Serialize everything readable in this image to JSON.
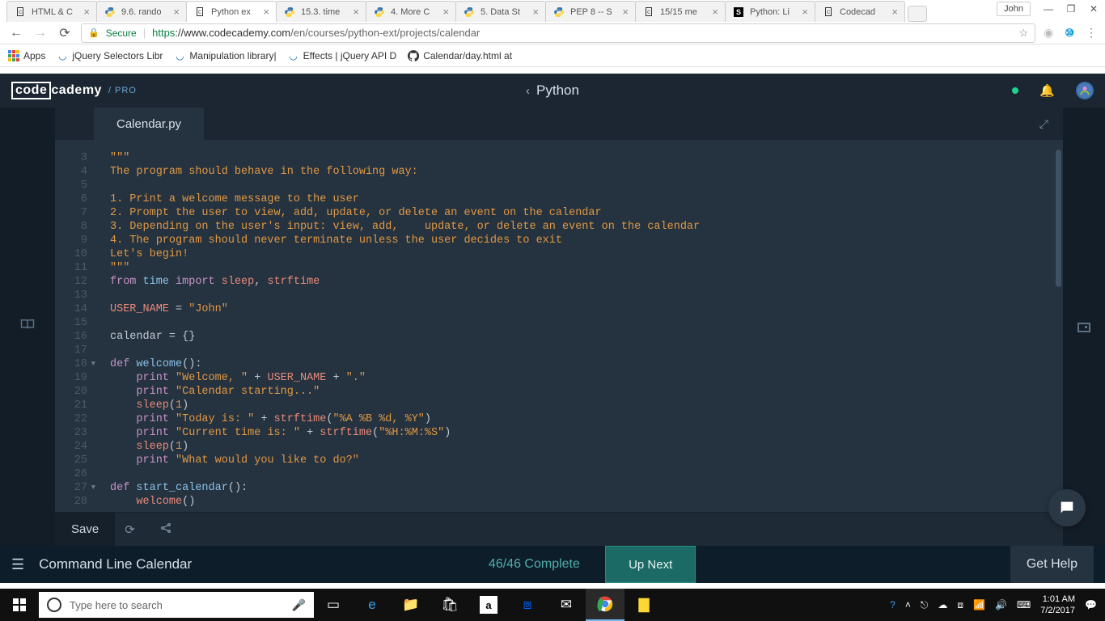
{
  "browser": {
    "tabs": [
      {
        "favicon": "cc",
        "title": "HTML & C"
      },
      {
        "favicon": "py",
        "title": "9.6. rando"
      },
      {
        "favicon": "cc",
        "title": "Python ex"
      },
      {
        "favicon": "py",
        "title": "15.3. time"
      },
      {
        "favicon": "py",
        "title": "4. More C"
      },
      {
        "favicon": "py",
        "title": "5. Data St"
      },
      {
        "favicon": "py",
        "title": "PEP 8 -- S"
      },
      {
        "favicon": "cc",
        "title": "15/15 me"
      },
      {
        "favicon": "s",
        "title": "Python: Li"
      },
      {
        "favicon": "cc",
        "title": "Codecad"
      }
    ],
    "active_tab_index": 2,
    "user_label": "John",
    "secure_label": "Secure",
    "url_proto": "https",
    "url_host": "://www.codecademy.com",
    "url_path": "/en/courses/python-ext/projects/calendar",
    "bookmarks": [
      {
        "label": "Apps"
      },
      {
        "label": "jQuery Selectors Libr"
      },
      {
        "label": "Manipulation library|"
      },
      {
        "label": "Effects | jQuery API D"
      },
      {
        "label": "Calendar/day.html at"
      }
    ]
  },
  "app": {
    "logo_left": "code",
    "logo_right": "cademy",
    "logo_pro": "/ PRO",
    "breadcrumb": "Python",
    "file_tab": "Calendar.py",
    "gutter_start": 3,
    "gutter_end": 28,
    "fold_lines": [
      18,
      27
    ],
    "code_rows": [
      [
        {
          "cls": "str",
          "t": "\"\"\""
        }
      ],
      [
        {
          "cls": "str",
          "t": "The program should behave in the following way:"
        }
      ],
      [],
      [
        {
          "cls": "str",
          "t": "1. Print a welcome message to the user"
        }
      ],
      [
        {
          "cls": "str",
          "t": "2. Prompt the user to view, add, update, or delete an event on the calendar"
        }
      ],
      [
        {
          "cls": "str",
          "t": "3. Depending on the user's input: view, add,    update, or delete an event on the calendar"
        }
      ],
      [
        {
          "cls": "str",
          "t": "4. The program should never terminate unless the user decides to exit"
        }
      ],
      [
        {
          "cls": "str",
          "t": "Let's begin!"
        }
      ],
      [
        {
          "cls": "str",
          "t": "\"\"\""
        }
      ],
      [
        {
          "cls": "kw",
          "t": "from"
        },
        {
          "cls": "op",
          "t": " "
        },
        {
          "cls": "kw2",
          "t": "time"
        },
        {
          "cls": "op",
          "t": " "
        },
        {
          "cls": "kw",
          "t": "import"
        },
        {
          "cls": "op",
          "t": " "
        },
        {
          "cls": "name",
          "t": "sleep"
        },
        {
          "cls": "op",
          "t": ", "
        },
        {
          "cls": "name",
          "t": "strftime"
        }
      ],
      [],
      [
        {
          "cls": "name",
          "t": "USER_NAME"
        },
        {
          "cls": "op",
          "t": " = "
        },
        {
          "cls": "str",
          "t": "\"John\""
        }
      ],
      [],
      [
        {
          "cls": "op",
          "t": "calendar = {}"
        }
      ],
      [],
      [
        {
          "cls": "kw",
          "t": "def"
        },
        {
          "cls": "op",
          "t": " "
        },
        {
          "cls": "fn",
          "t": "welcome"
        },
        {
          "cls": "op",
          "t": "():"
        }
      ],
      [
        {
          "cls": "op",
          "t": "    "
        },
        {
          "cls": "kw",
          "t": "print"
        },
        {
          "cls": "op",
          "t": " "
        },
        {
          "cls": "str",
          "t": "\"Welcome, \""
        },
        {
          "cls": "op",
          "t": " + "
        },
        {
          "cls": "name",
          "t": "USER_NAME"
        },
        {
          "cls": "op",
          "t": " + "
        },
        {
          "cls": "str",
          "t": "\".\""
        }
      ],
      [
        {
          "cls": "op",
          "t": "    "
        },
        {
          "cls": "kw",
          "t": "print"
        },
        {
          "cls": "op",
          "t": " "
        },
        {
          "cls": "str",
          "t": "\"Calendar starting...\""
        }
      ],
      [
        {
          "cls": "op",
          "t": "    "
        },
        {
          "cls": "name",
          "t": "sleep"
        },
        {
          "cls": "op",
          "t": "("
        },
        {
          "cls": "num",
          "t": "1"
        },
        {
          "cls": "op",
          "t": ")"
        }
      ],
      [
        {
          "cls": "op",
          "t": "    "
        },
        {
          "cls": "kw",
          "t": "print"
        },
        {
          "cls": "op",
          "t": " "
        },
        {
          "cls": "str",
          "t": "\"Today is: \""
        },
        {
          "cls": "op",
          "t": " + "
        },
        {
          "cls": "name",
          "t": "strftime"
        },
        {
          "cls": "op",
          "t": "("
        },
        {
          "cls": "str",
          "t": "\"%A %B %d, %Y\""
        },
        {
          "cls": "op",
          "t": ")"
        }
      ],
      [
        {
          "cls": "op",
          "t": "    "
        },
        {
          "cls": "kw",
          "t": "print"
        },
        {
          "cls": "op",
          "t": " "
        },
        {
          "cls": "str",
          "t": "\"Current time is: \""
        },
        {
          "cls": "op",
          "t": " + "
        },
        {
          "cls": "name",
          "t": "strftime"
        },
        {
          "cls": "op",
          "t": "("
        },
        {
          "cls": "str",
          "t": "\"%H:%M:%S\""
        },
        {
          "cls": "op",
          "t": ")"
        }
      ],
      [
        {
          "cls": "op",
          "t": "    "
        },
        {
          "cls": "name",
          "t": "sleep"
        },
        {
          "cls": "op",
          "t": "("
        },
        {
          "cls": "num",
          "t": "1"
        },
        {
          "cls": "op",
          "t": ")"
        }
      ],
      [
        {
          "cls": "op",
          "t": "    "
        },
        {
          "cls": "kw",
          "t": "print"
        },
        {
          "cls": "op",
          "t": " "
        },
        {
          "cls": "str",
          "t": "\"What would you like to do?\""
        }
      ],
      [],
      [
        {
          "cls": "kw",
          "t": "def"
        },
        {
          "cls": "op",
          "t": " "
        },
        {
          "cls": "fn",
          "t": "start_calendar"
        },
        {
          "cls": "op",
          "t": "():"
        }
      ],
      [
        {
          "cls": "op",
          "t": "    "
        },
        {
          "cls": "name",
          "t": "welcome"
        },
        {
          "cls": "op",
          "t": "()"
        }
      ]
    ],
    "save_label": "Save",
    "footer_title": "Command Line Calendar",
    "progress": "46/46 Complete",
    "upnext": "Up Next",
    "gethelp": "Get Help"
  },
  "taskbar": {
    "search_placeholder": "Type here to search",
    "time": "1:01 AM",
    "date": "7/2/2017"
  }
}
